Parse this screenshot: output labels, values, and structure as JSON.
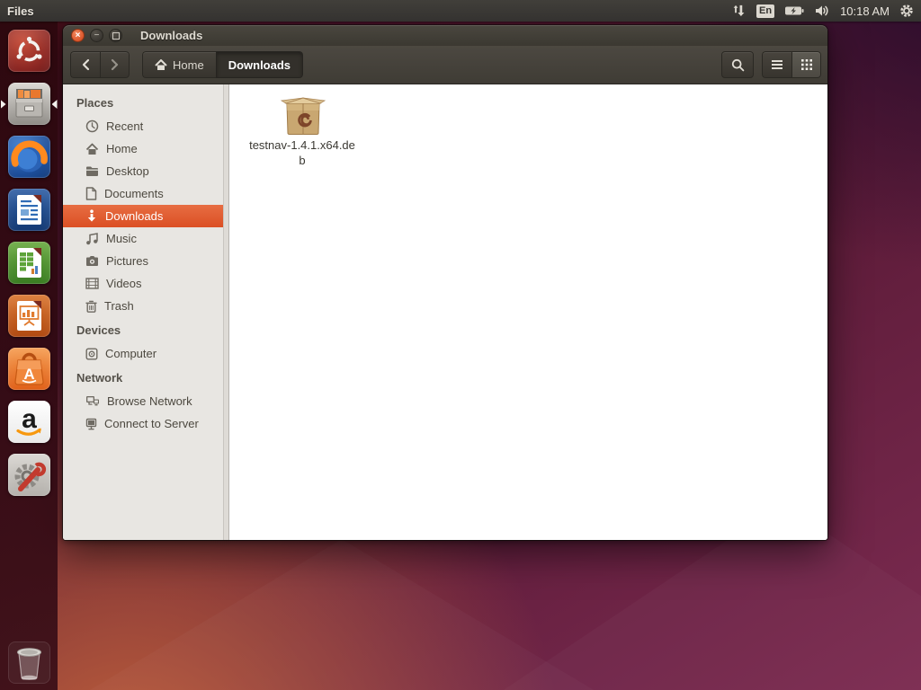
{
  "colors": {
    "ubuntu_orange": "#e95420",
    "selection_gradient_top": "#e76d42",
    "selection_gradient_bottom": "#db4f24",
    "titlebar": "#3e3b33",
    "sidebar_bg": "#e8e6e2",
    "main_bg": "#ffffff",
    "topbar_bg": "#3a3834"
  },
  "topbar": {
    "app_name": "Files",
    "keyboard_indicator": "En",
    "time": "10:18 AM",
    "tray_icons": [
      "network-arrows-icon",
      "keyboard-layout-indicator",
      "battery-icon",
      "volume-icon",
      "session-gear-icon"
    ]
  },
  "window": {
    "title": "Downloads",
    "toolbar": {
      "breadcrumbs": [
        {
          "label": "Home",
          "active": false
        },
        {
          "label": "Downloads",
          "active": true
        }
      ]
    },
    "sidebar": {
      "sections": [
        {
          "header": "Places",
          "items": [
            {
              "label": "Recent",
              "icon": "recent-clock-icon",
              "selected": false
            },
            {
              "label": "Home",
              "icon": "home-icon",
              "selected": false
            },
            {
              "label": "Desktop",
              "icon": "folder-icon",
              "selected": false
            },
            {
              "label": "Documents",
              "icon": "document-icon",
              "selected": false
            },
            {
              "label": "Downloads",
              "icon": "downloads-arrow-icon",
              "selected": true
            },
            {
              "label": "Music",
              "icon": "music-note-icon",
              "selected": false
            },
            {
              "label": "Pictures",
              "icon": "camera-icon",
              "selected": false
            },
            {
              "label": "Videos",
              "icon": "film-icon",
              "selected": false
            },
            {
              "label": "Trash",
              "icon": "trash-icon",
              "selected": false
            }
          ]
        },
        {
          "header": "Devices",
          "items": [
            {
              "label": "Computer",
              "icon": "drive-icon",
              "selected": false
            }
          ]
        },
        {
          "header": "Network",
          "items": [
            {
              "label": "Browse Network",
              "icon": "network-computers-icon",
              "selected": false
            },
            {
              "label": "Connect to Server",
              "icon": "server-monitor-icon",
              "selected": false
            }
          ]
        }
      ]
    },
    "main": {
      "files": [
        {
          "name": "testnav-1.4.1.x64.deb",
          "type": "debian-package"
        }
      ]
    }
  },
  "launcher": {
    "items": [
      {
        "name": "Ubuntu Dash"
      },
      {
        "name": "Files",
        "running": true,
        "focused": true
      },
      {
        "name": "Firefox"
      },
      {
        "name": "LibreOffice Writer"
      },
      {
        "name": "LibreOffice Calc"
      },
      {
        "name": "LibreOffice Impress"
      },
      {
        "name": "Ubuntu Software Center"
      },
      {
        "name": "Amazon"
      },
      {
        "name": "System Settings"
      },
      {
        "name": "Trash"
      }
    ]
  }
}
